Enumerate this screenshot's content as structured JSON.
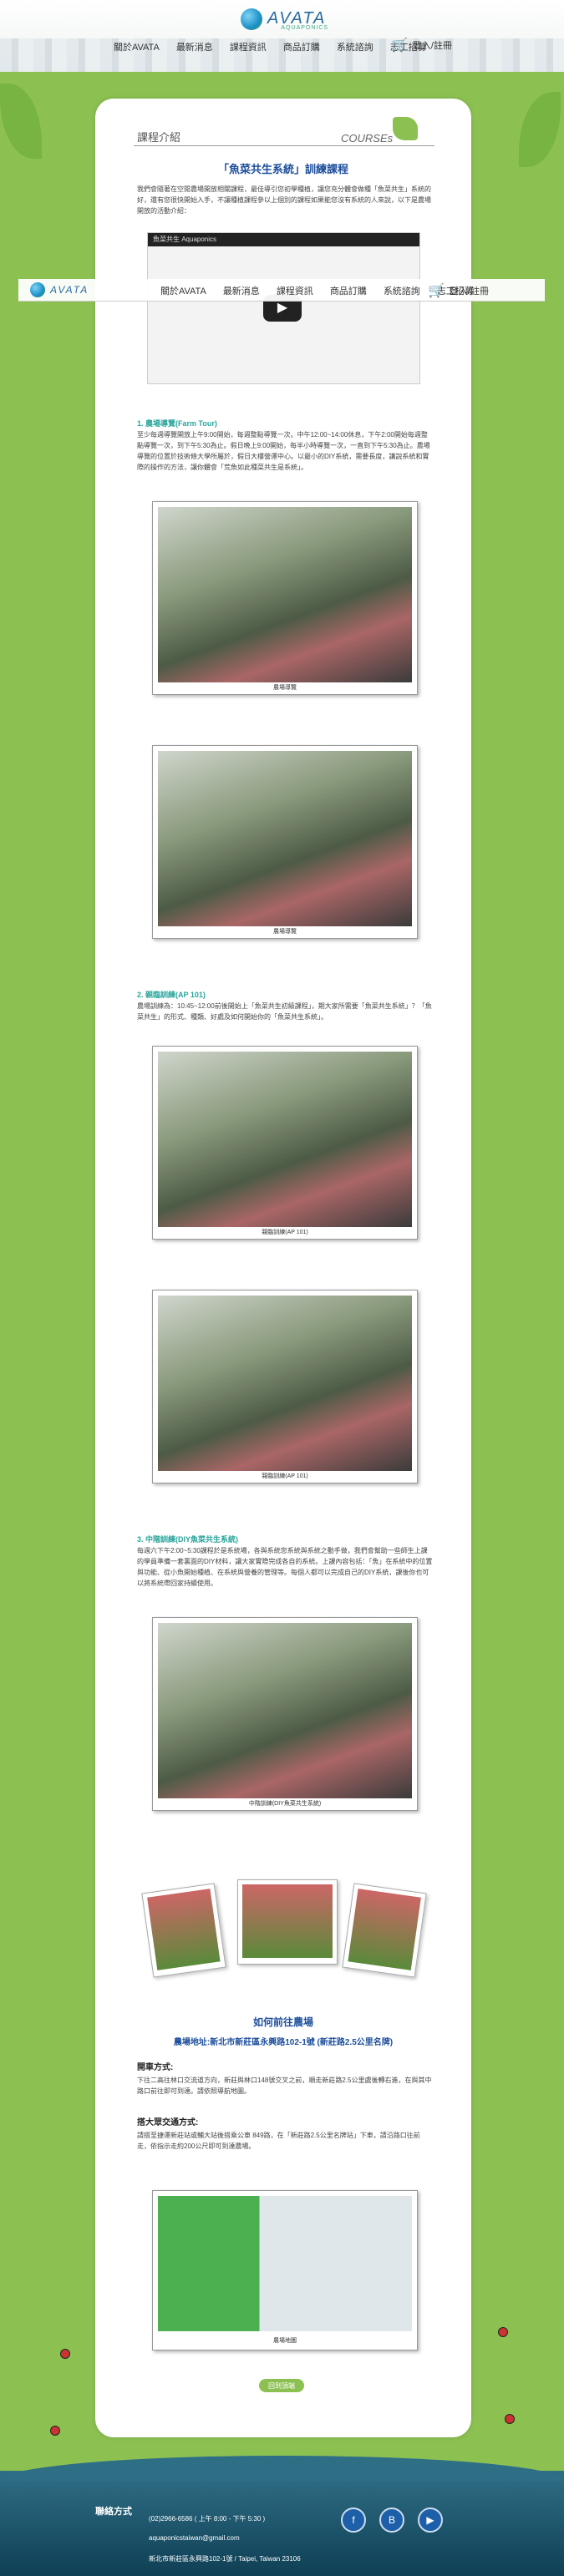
{
  "header": {
    "logo_text": "AVATA",
    "logo_sub": "AQUAPONICS",
    "nav": [
      "關於AVATA",
      "最新消息",
      "課程資訊",
      "商品訂購",
      "系統諮詢",
      "志工招募"
    ],
    "cart_label": "登入/註冊"
  },
  "page": {
    "title": "課程介紹",
    "title_en": "COURSEs",
    "main_heading": "「魚菜共生系統」訓練課程",
    "intro": "我們會隨著在空閒農場開放相關課程，最佳導引您初學種植，讓您充分體會做種「魚菜共生」系統的好，還有您很快開始入手，不讓種植課程參以上個別的課程如果能您沒有系統的人來說，以下是農場開放的活動介紹：",
    "video_title": "魚菜共生 Aquaponics",
    "sec1_title": "1. 農場導覽(Farm Tour)",
    "sec1_text": "至少每週導覽開放上午9:00開始，每週整點導覽一次。中午12:00~14:00休息，下午2:00開始每週整點導覽一次，到下午5:30為止。假日晚上9:00開始，每半小時導覽一次，一直到下午5:30為止。農場導覽的位置於技術條大學所屬於，假日大樓營運中心。以最小的DIY系統，需要長度，講說系統和實際的操作的方法，讓你體會「荒魚如此種菜共生是系統」。",
    "photo1_cap": "農場導覽",
    "photo2_cap": "農場導覽",
    "sec2_title": "2. 親臨訓練(AP 101)",
    "sec2_text": "農場訓練為：10:45~12:00前後開始上「魚菜共生初級課程」，期大家所需要「魚菜共生系統」？「魚菜共生」的形式、種類、好處及如何開始你的「魚菜共生系統」。",
    "photo3_cap": "親臨訓練(AP 101)",
    "photo4_cap": "親臨訓練(AP 101)",
    "sec3_title": "3. 中階訓練(DIY魚菜共生系統)",
    "sec3_text": "每週六下午2:00~5:30課程於是系統場，各與系統您系統與系統之動手做，我們會幫助一些師生上課的學員準備一套裏面的DIY材料，讓大家實際完成各自的系統。上課內容包括：「魚」在系統中的位置與功能、從小魚開始種植、在系統與營養的管理等。每個人都可以完成自己的DIY系統，課後你也可以將系統帶回家持續使用。",
    "photo5_cap": "中階訓練(DIY魚菜共生系統)",
    "how_heading": "如何前往農場",
    "address": "農場地址:新北市新莊區永興路102-1號 (新莊路2.5公里名牌)",
    "drive_title": "開車方式:",
    "drive_text": "下往二高往林口交流道方向，新莊與林口148號交叉之前，順走新莊路2.5公里處後轉右進，在與其中路口前往即可到達。請依照導航地圖。",
    "bus_title": "搭大眾交通方式:",
    "bus_text": "請搭至捷運新莊站或輔大站後搭乘公車 849路，在「新莊路2.5公里名牌站」下車，請沿路口往前走，依指示走約200公尺即可到達農場。",
    "map_cap": "農場地圖",
    "back_btn": "回到頂端"
  },
  "footer": {
    "contact_label": "聯絡方式",
    "phone": "(02)2966-6586 ( 上午 8:00 - 下午 5:30 )",
    "email": "aquaponicstaiwan@gmail.com",
    "address": "新北市新莊區永興路102-1號 / Taipei, Taiwan 23106"
  },
  "colors": {
    "accent": "#8cc152",
    "heading_blue": "#1d4f9c",
    "section_teal": "#2aa59c",
    "footer_bg": "#2f6f86"
  }
}
